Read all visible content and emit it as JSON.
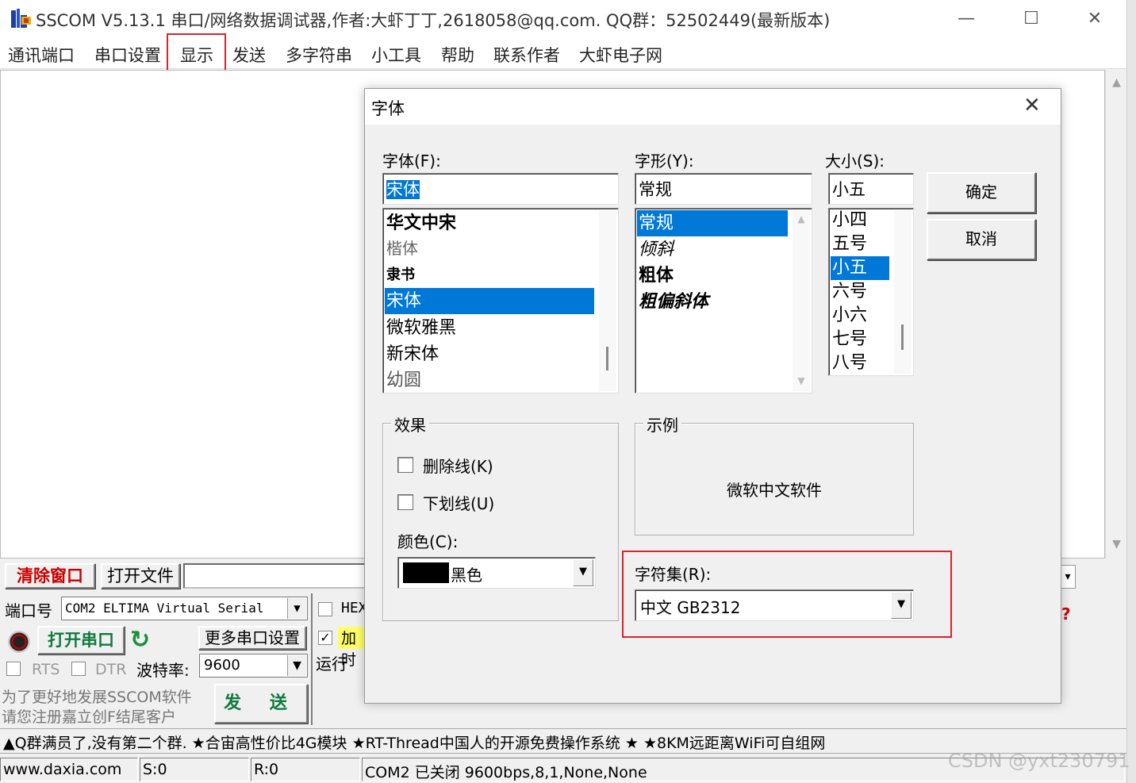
{
  "window": {
    "title": "SSCOM V5.13.1 串口/网络数据调试器,作者:大虾丁丁,2618058@qq.com. QQ群：52502449(最新版本)",
    "minimize_glyph": "—",
    "maximize_glyph": "☐",
    "close_glyph": "✕"
  },
  "menu": {
    "items": [
      "通讯端口",
      "串口设置",
      "显示",
      "发送",
      "多字符串",
      "小工具",
      "帮助",
      "联系作者",
      "大虾电子网"
    ],
    "highlighted": "显示"
  },
  "controls": {
    "clear_window": "清除窗口",
    "open_file": "打开文件",
    "port_label": "端口号",
    "port_value": "COM2 ELTIMA Virtual Serial",
    "open_port": "打开串口",
    "more_settings": "更多串口设置",
    "rts": "RTS",
    "dtr": "DTR",
    "baud_label": "波特率:",
    "baud_value": "9600",
    "hex_label": "HEX",
    "add_label": "加时",
    "run_label": "运行",
    "promo_line1": "为了更好地发展SSCOM软件",
    "promo_line2": "请您注册嘉立创F结尾客户",
    "send": "发 送",
    "refresh_glyph": "↻",
    "help_glyph": "?"
  },
  "announcement": "▲Q群满员了,没有第二个群. ★合宙高性价比4G模块 ★RT-Thread中国人的开源免费操作系统 ★ ★8KM远距离WiFi可自组网",
  "status": {
    "site": "www.daxia.com",
    "sent": "S:0",
    "received": "R:0",
    "port_state": "COM2 已关闭  9600bps,8,1,None,None"
  },
  "watermark": "CSDN @yxt230791",
  "font_dialog": {
    "title": "字体",
    "close_glyph": "✕",
    "font_label": "字体(F):",
    "font_value": "宋体",
    "fonts": [
      "华文中宋",
      "楷体",
      "隶书",
      "宋体",
      "微软雅黑",
      "新宋体",
      "幼圆"
    ],
    "selected_font": "宋体",
    "style_label": "字形(Y):",
    "style_value": "常规",
    "styles": [
      "常规",
      "倾斜",
      "粗体",
      "粗偏斜体"
    ],
    "selected_style": "常规",
    "size_label": "大小(S):",
    "size_value": "小五",
    "sizes": [
      "小四",
      "五号",
      "小五",
      "六号",
      "小六",
      "七号",
      "八号"
    ],
    "selected_size": "小五",
    "ok": "确定",
    "cancel": "取消",
    "effects_title": "效果",
    "strikeout": "删除线(K)",
    "underline": "下划线(U)",
    "color_label": "颜色(C):",
    "color_value": "黑色",
    "color_swatch": "#000000",
    "sample_title": "示例",
    "sample_text": "微软中文软件",
    "charset_label": "字符集(R):",
    "charset_value": "中文 GB2312"
  },
  "colors": {
    "selection": "#0078d7",
    "highlight_box": "#d9232d",
    "green_action": "#0e7a3e",
    "clear_red": "#cc0000"
  }
}
